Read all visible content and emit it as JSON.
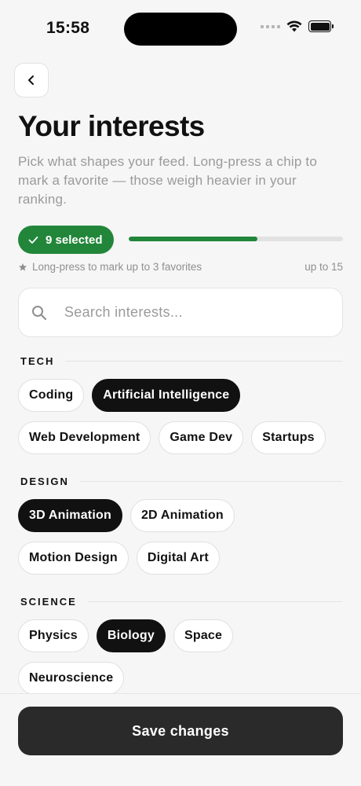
{
  "status_bar": {
    "time": "15:58"
  },
  "header": {
    "title": "Your interests",
    "subtitle": "Pick what shapes your feed. Long-press a chip to mark a favorite — those weigh heavier in your ranking."
  },
  "selection": {
    "badge_label": "9 selected",
    "selected_count": 9,
    "max_count": 15,
    "progress_fraction": 0.6,
    "hint": "Long-press to mark up to 3 favorites",
    "limit_label": "up to 15"
  },
  "search": {
    "placeholder": "Search interests..."
  },
  "sections": [
    {
      "label": "TECH",
      "chips": [
        {
          "label": "Coding",
          "selected": false
        },
        {
          "label": "Artificial Intelligence",
          "selected": true
        },
        {
          "label": "Web Development",
          "selected": false
        },
        {
          "label": "Game Dev",
          "selected": false
        },
        {
          "label": "Startups",
          "selected": false
        }
      ]
    },
    {
      "label": "DESIGN",
      "chips": [
        {
          "label": "3D Animation",
          "selected": true
        },
        {
          "label": "2D Animation",
          "selected": false
        },
        {
          "label": "Motion Design",
          "selected": false
        },
        {
          "label": "Digital Art",
          "selected": false
        }
      ]
    },
    {
      "label": "SCIENCE",
      "chips": [
        {
          "label": "Physics",
          "selected": false
        },
        {
          "label": "Biology",
          "selected": true
        },
        {
          "label": "Space",
          "selected": false
        },
        {
          "label": "Neuroscience",
          "selected": false
        }
      ]
    }
  ],
  "footer": {
    "save_label": "Save changes"
  },
  "colors": {
    "accent_green": "#22863a",
    "selected_chip": "#111111",
    "save_button": "#2a2a2a"
  },
  "icons": [
    "back-chevron-icon",
    "check-icon",
    "star-icon",
    "search-icon",
    "wifi-icon",
    "battery-icon"
  ]
}
